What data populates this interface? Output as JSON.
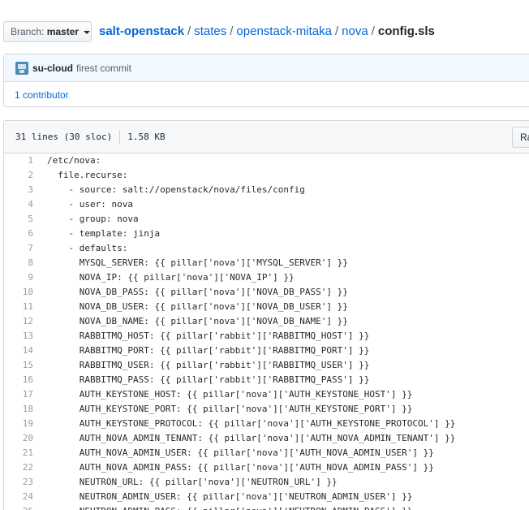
{
  "branch": {
    "prefix": "Branch:",
    "name": "master"
  },
  "breadcrumb": {
    "repo": "salt-openstack",
    "parts": [
      "states",
      "openstack-mitaka",
      "nova"
    ],
    "file": "config.sls"
  },
  "commit": {
    "author": "su-cloud",
    "message": "firest commit",
    "avatar_icon": "user-avatar"
  },
  "contributors": "1 contributor",
  "file_info": {
    "lines": "31 lines (30 sloc)",
    "size": "1.58 KB",
    "raw_label": "Ra"
  },
  "code_lines": [
    {
      "n": "1",
      "text": "/etc/nova:"
    },
    {
      "n": "2",
      "text": "  file.recurse:"
    },
    {
      "n": "3",
      "text": "    - source: salt://openstack/nova/files/config"
    },
    {
      "n": "4",
      "text": "    - user: nova"
    },
    {
      "n": "5",
      "text": "    - group: nova"
    },
    {
      "n": "6",
      "text": "    - template: jinja"
    },
    {
      "n": "7",
      "text": "    - defaults:"
    },
    {
      "n": "8",
      "text": "      MYSQL_SERVER: {{ pillar['nova']['MYSQL_SERVER'] }}"
    },
    {
      "n": "9",
      "text": "      NOVA_IP: {{ pillar['nova']['NOVA_IP'] }}"
    },
    {
      "n": "10",
      "text": "      NOVA_DB_PASS: {{ pillar['nova']['NOVA_DB_PASS'] }}"
    },
    {
      "n": "11",
      "text": "      NOVA_DB_USER: {{ pillar['nova']['NOVA_DB_USER'] }}"
    },
    {
      "n": "12",
      "text": "      NOVA_DB_NAME: {{ pillar['nova']['NOVA_DB_NAME'] }}"
    },
    {
      "n": "13",
      "text": "      RABBITMQ_HOST: {{ pillar['rabbit']['RABBITMQ_HOST'] }}"
    },
    {
      "n": "14",
      "text": "      RABBITMQ_PORT: {{ pillar['rabbit']['RABBITMQ_PORT'] }}"
    },
    {
      "n": "15",
      "text": "      RABBITMQ_USER: {{ pillar['rabbit']['RABBITMQ_USER'] }}"
    },
    {
      "n": "16",
      "text": "      RABBITMQ_PASS: {{ pillar['rabbit']['RABBITMQ_PASS'] }}"
    },
    {
      "n": "17",
      "text": "      AUTH_KEYSTONE_HOST: {{ pillar['nova']['AUTH_KEYSTONE_HOST'] }}"
    },
    {
      "n": "18",
      "text": "      AUTH_KEYSTONE_PORT: {{ pillar['nova']['AUTH_KEYSTONE_PORT'] }}"
    },
    {
      "n": "19",
      "text": "      AUTH_KEYSTONE_PROTOCOL: {{ pillar['nova']['AUTH_KEYSTONE_PROTOCOL'] }}"
    },
    {
      "n": "20",
      "text": "      AUTH_NOVA_ADMIN_TENANT: {{ pillar['nova']['AUTH_NOVA_ADMIN_TENANT'] }}"
    },
    {
      "n": "21",
      "text": "      AUTH_NOVA_ADMIN_USER: {{ pillar['nova']['AUTH_NOVA_ADMIN_USER'] }}"
    },
    {
      "n": "22",
      "text": "      AUTH_NOVA_ADMIN_PASS: {{ pillar['nova']['AUTH_NOVA_ADMIN_PASS'] }}"
    },
    {
      "n": "23",
      "text": "      NEUTRON_URL: {{ pillar['nova']['NEUTRON_URL'] }}"
    },
    {
      "n": "24",
      "text": "      NEUTRON_ADMIN_USER: {{ pillar['nova']['NEUTRON_ADMIN_USER'] }}"
    },
    {
      "n": "25",
      "text": "      NEUTRON_ADMIN_PASS: {{ pillar['nova']['NEUTRON_ADMIN_PASS'] }}"
    }
  ]
}
